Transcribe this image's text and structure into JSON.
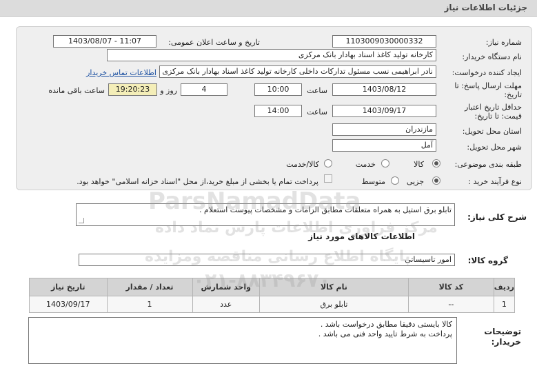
{
  "header": {
    "title": "جزئیات اطلاعات نیاز"
  },
  "form": {
    "need_number_label": "شماره نیاز:",
    "need_number": "1103009030000332",
    "announce_label": "تاریخ و ساعت اعلان عمومی:",
    "announce_value": "1403/08/07 - 11:07",
    "buyer_org_label": "نام دستگاه خریدار:",
    "buyer_org": "کارخانه تولید کاغذ اسناد بهادار بانک مرکزی",
    "creator_label": "ایجاد کننده درخواست:",
    "creator": "نادر ابراهیمی نسب مسئول تدارکات داخلی کارخانه تولید کاغذ اسناد بهادار بانک مرکزی",
    "contact_link": "اطلاعات تماس خریدار",
    "deadline_label_1": "مهلت ارسال پاسخ: تا",
    "deadline_label_2": "تاریخ:",
    "deadline_date": "1403/08/12",
    "time_label": "ساعت",
    "deadline_time": "10:00",
    "days_value": "4",
    "days_label": "روز و",
    "remaining_time": "19:20:23",
    "remaining_label": "ساعت باقی مانده",
    "validity_label_1": "حداقل تاریخ اعتبار",
    "validity_label_2": "قیمت: تا تاریخ:",
    "validity_date": "1403/09/17",
    "validity_time": "14:00",
    "province_label": "استان محل تحویل:",
    "province": "مازندران",
    "city_label": "شهر محل تحویل:",
    "city": "آمل",
    "category_label": "طبقه بندی موضوعی:",
    "category_options": [
      "کالا",
      "خدمت",
      "کالا/خدمت"
    ],
    "category_selected": "کالا",
    "process_label": "نوع فرآیند خرید :",
    "process_options": [
      "جزیی",
      "متوسط"
    ],
    "process_selected": "جزیی",
    "payment_note": "پرداخت تمام یا بخشی از مبلغ خرید،از محل \"اسناد خزانه اسلامی\" خواهد بود."
  },
  "description": {
    "label": "شرح کلی نیاز:",
    "text": "تابلو برق استیل به همراه متعلقات مطابق الزامات و مشخصات پیوست استعلام ."
  },
  "goods": {
    "section_title": "اطلاعات کالاهای مورد نیاز",
    "group_label": "گروه کالا:",
    "group_value": "امور تاسیساتی",
    "table": {
      "headers": [
        "ردیف",
        "کد کالا",
        "نام کالا",
        "واحد شمارش",
        "تعداد / مقدار",
        "تاریخ نیاز"
      ],
      "rows": [
        [
          "1",
          "--",
          "تابلو برق",
          "عدد",
          "1",
          "1403/09/17"
        ]
      ]
    }
  },
  "buyer_notes": {
    "label_1": "توضیحات",
    "label_2": "خریدار:",
    "line1": "کالا بایستی دقیقا مطابق درخواست باشد .",
    "line2": "پرداخت به شرط تایید واحد فنی می باشد ."
  },
  "watermark": {
    "brand": "ParsNamadData",
    "line1": "مرکز فراوری اطلاعات پارس نماد داده",
    "line2": "پایگاه اطلاع رسانی مناقصه ومزایده",
    "phone": "۰۲۱-۸۸۳۴۹۶۷۰"
  },
  "colors": {
    "header_bg": "#dcdcdc",
    "panel_bg": "#efefef",
    "highlight": "#f4eeb8",
    "link": "#1a4fa0"
  }
}
